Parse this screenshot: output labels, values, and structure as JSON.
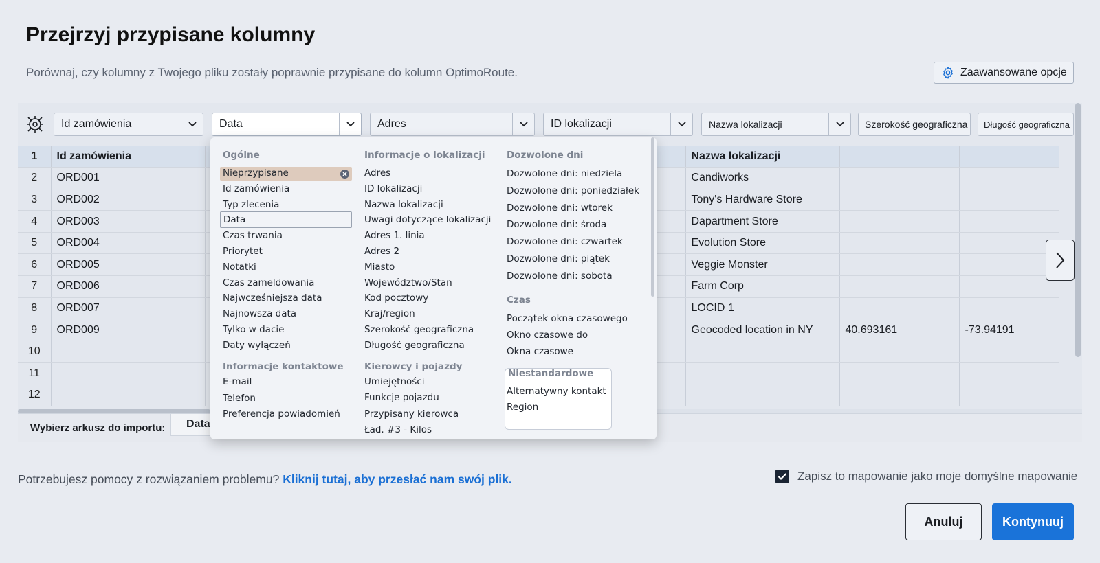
{
  "header": {
    "title": "Przejrzyj przypisane kolumny",
    "subtitle": "Porównaj, czy kolumny z Twojego pliku zostały poprawnie przypisane do kolumn OptimoRoute.",
    "advanced_label": "Zaawansowane opcje"
  },
  "mapping": [
    "Id zamówienia",
    "Data",
    "Adres",
    "ID lokalizacji",
    "Nazwa lokalizacji",
    "Szerokość geograficzna",
    "Długość geograficzna"
  ],
  "table": {
    "header_row": {
      "num": "1",
      "order_id": "Id zamówienia",
      "location_name": "Nazwa lokalizacji"
    },
    "rows": [
      {
        "num": "2",
        "order_id": "ORD001",
        "location_name": "Candiworks",
        "lat": "",
        "lng": ""
      },
      {
        "num": "3",
        "order_id": "ORD002",
        "location_name": "Tony's Hardware Store",
        "lat": "",
        "lng": ""
      },
      {
        "num": "4",
        "order_id": "ORD003",
        "location_name": "Dapartment Store",
        "lat": "",
        "lng": ""
      },
      {
        "num": "5",
        "order_id": "ORD004",
        "location_name": "Evolution Store",
        "lat": "",
        "lng": ""
      },
      {
        "num": "6",
        "order_id": "ORD005",
        "location_name": "Veggie Monster",
        "lat": "",
        "lng": ""
      },
      {
        "num": "7",
        "order_id": "ORD006",
        "location_name": "Farm Corp",
        "lat": "",
        "lng": ""
      },
      {
        "num": "8",
        "order_id": "ORD007",
        "location_name": "LOCID 1",
        "lat": "",
        "lng": ""
      },
      {
        "num": "9",
        "order_id": "ORD009",
        "location_name": "Geocoded location in NY",
        "lat": "40.693161",
        "lng": "-73.94191"
      },
      {
        "num": "10",
        "order_id": "",
        "location_name": "",
        "lat": "",
        "lng": ""
      },
      {
        "num": "11",
        "order_id": "",
        "location_name": "",
        "lat": "",
        "lng": ""
      },
      {
        "num": "12",
        "order_id": "",
        "location_name": "",
        "lat": "",
        "lng": ""
      }
    ]
  },
  "dropdown": {
    "general": {
      "heading": "Ogólne",
      "items": [
        "Nieprzypisane",
        "Id zamówienia",
        "Typ zlecenia",
        "Data",
        "Czas trwania",
        "Priorytet",
        "Notatki",
        "Czas zameldowania",
        "Najwcześniejsza data",
        "Najnowsza data",
        "Tylko w dacie",
        "Daty wyłączeń"
      ]
    },
    "contact": {
      "heading": "Informacje kontaktowe",
      "items": [
        "E-mail",
        "Telefon",
        "Preferencja powiadomień"
      ]
    },
    "location": {
      "heading": "Informacje o lokalizacji",
      "items": [
        "Adres",
        "ID lokalizacji",
        "Nazwa lokalizacji",
        "Uwagi dotyczące lokalizacji",
        "Adres 1. linia",
        "Adres 2",
        "Miasto",
        "Województwo/Stan",
        "Kod pocztowy",
        "Kraj/region",
        "Szerokość geograficzna",
        "Długość geograficzna"
      ]
    },
    "drivers": {
      "heading": "Kierowcy i pojazdy",
      "items": [
        "Umiejętności",
        "Funkcje pojazdu",
        "Przypisany kierowca",
        "Ład. #3 - Kilos"
      ]
    },
    "days": {
      "heading": "Dozwolone dni",
      "items": [
        "Dozwolone dni: niedziela",
        "Dozwolone dni: poniedziałek",
        "Dozwolone dni: wtorek",
        "Dozwolone dni: środa",
        "Dozwolone dni: czwartek",
        "Dozwolone dni: piątek",
        "Dozwolone dni: sobota"
      ]
    },
    "time": {
      "heading": "Czas",
      "items": [
        "Początek okna czasowego",
        "Okno czasowe do",
        "Okna czasowe"
      ]
    },
    "custom": {
      "heading": "Niestandardowe",
      "items": [
        "Alternatywny kontakt",
        "Region"
      ]
    }
  },
  "sheet": {
    "label": "Wybierz arkusz do importu:",
    "tab": "Data"
  },
  "footer": {
    "help_text": "Potrzebujesz pomocy z rozwiązaniem problemu?",
    "help_link": "Kliknij tutaj, aby przesłać nam swój plik.",
    "save_default": "Zapisz to mapowanie jako moje domyślne mapowanie",
    "cancel": "Anuluj",
    "continue": "Kontynuuj"
  },
  "colors": {
    "accent": "#1a73d9",
    "selected_item": "#decbbd",
    "header_row": "#d7e0ec"
  },
  "icons": [
    "gear-icon",
    "column-settings-icon",
    "chevron-down-icon",
    "chevron-right-icon",
    "clear-icon",
    "checkmark-icon"
  ]
}
